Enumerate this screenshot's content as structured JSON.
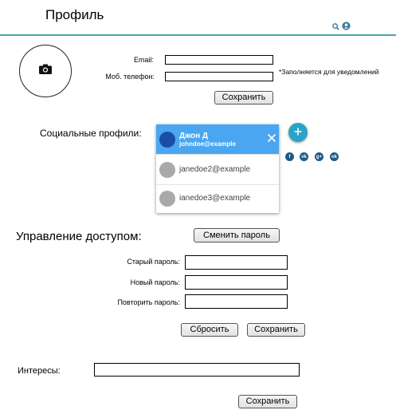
{
  "header": {
    "title": "Профиль",
    "search_icon": "search-icon",
    "user_icon": "user-circle-icon"
  },
  "profile": {
    "avatar_icon": "camera-icon",
    "email_label": "Email:",
    "email_value": "",
    "phone_label": "Моб. телефон:",
    "phone_value": "",
    "notify_note": "*Заполняется для уведомлений",
    "save_label": "Сохранить"
  },
  "social": {
    "label": "Социальные профили:",
    "accounts": [
      {
        "name": "Джон Д",
        "email": "johndoe@example",
        "selected": true
      },
      {
        "email": "janedoe2@example"
      },
      {
        "email": "ianedoe3@example"
      }
    ],
    "add_icon": "plus-icon",
    "networks": [
      "f",
      "vk",
      "g+",
      "ok"
    ]
  },
  "access": {
    "title": "Управление доступом:",
    "change_password_label": "Сменить пароль",
    "old_password_label": "Старый пароль:",
    "new_password_label": "Новый пароль:",
    "repeat_password_label": "Повторить пароль:",
    "reset_label": "Сбросить",
    "save_label": "Сохранить"
  },
  "interests": {
    "label": "Интересы:",
    "value": "",
    "save_label": "Сохранить"
  },
  "colors": {
    "accent": "#4aa3a8",
    "selected_row": "#4aa6f0",
    "fab": "#2aa3c7",
    "social_badge": "#1f5a86"
  }
}
